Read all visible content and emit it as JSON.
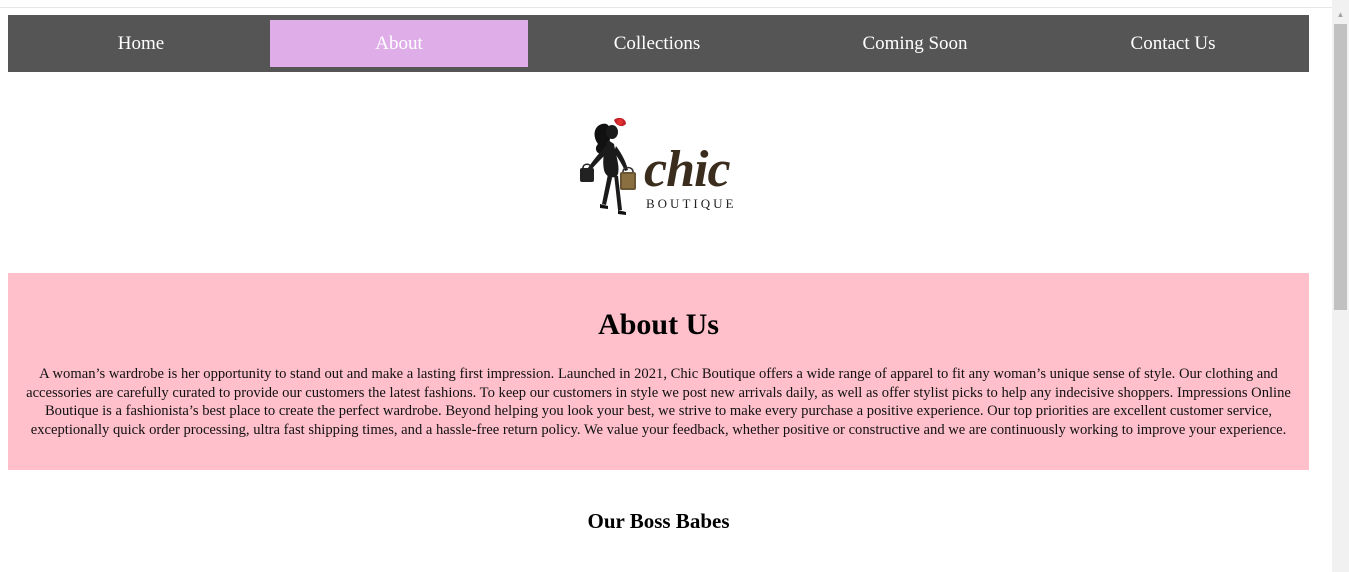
{
  "nav": {
    "items": [
      {
        "label": "Home",
        "active": false
      },
      {
        "label": "About",
        "active": true
      },
      {
        "label": "Collections",
        "active": false
      },
      {
        "label": "Coming Soon",
        "active": false
      },
      {
        "label": "Contact Us",
        "active": false
      }
    ],
    "active_color": "#dfaee9",
    "bar_color": "#555555"
  },
  "logo": {
    "wordmark": "chic",
    "subtext": "BOUTIQUE"
  },
  "about": {
    "title": "About Us",
    "body": "A woman’s wardrobe is her opportunity to stand out and make a lasting first impression. Launched in 2021, Chic Boutique offers a wide range of apparel to fit any woman’s unique sense of style. Our clothing and accessories are carefully curated to provide our customers the latest fashions. To keep our customers in style we post new arrivals daily, as well as offer stylist picks to help any indecisive shoppers. Impressions Online Boutique is a fashionista’s best place to create the perfect wardrobe. Beyond helping you look your best, we strive to make every purchase a positive experience. Our top priorities are excellent customer service, exceptionally quick order processing, ultra fast shipping times, and a hassle-free return policy. We value your feedback, whether positive or constructive and we are continuously working to improve your experience.",
    "band_color": "#ffc0cb"
  },
  "team": {
    "title": "Our Boss Babes"
  }
}
